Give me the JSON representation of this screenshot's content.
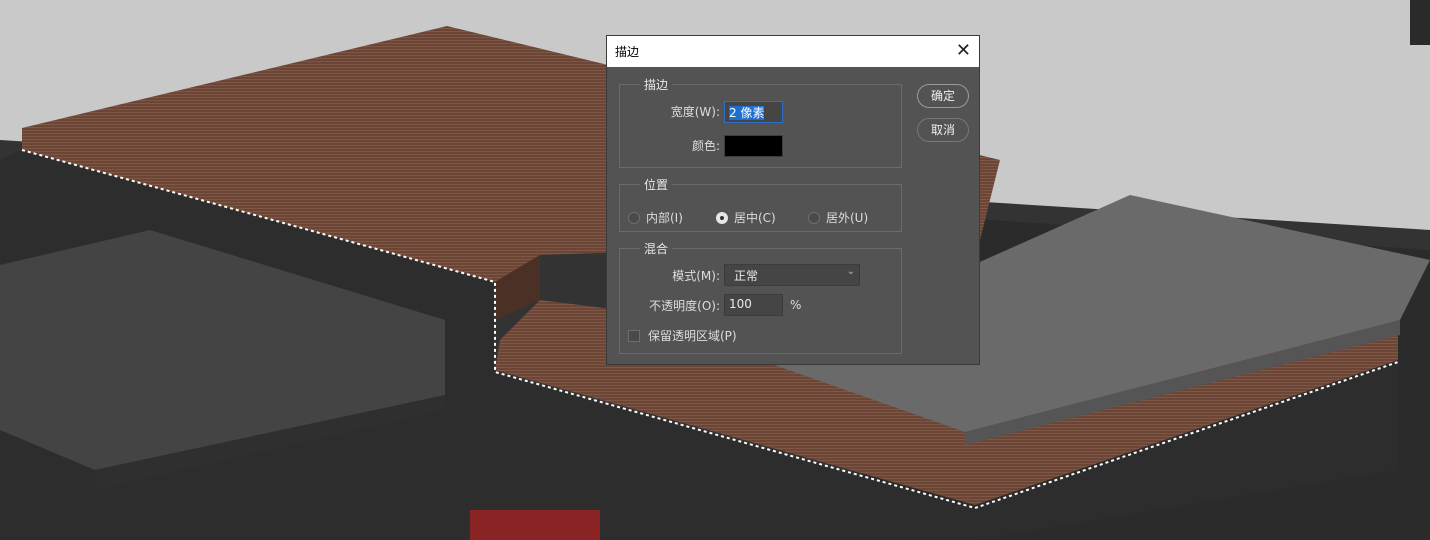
{
  "dialog": {
    "title": "描边",
    "stroke_group": {
      "legend": "描边",
      "width_label": "宽度(W):",
      "width_value": "2 像素",
      "color_label": "颜色:",
      "color_value": "#000000"
    },
    "position_group": {
      "legend": "位置",
      "options": [
        "内部(I)",
        "居中(C)",
        "居外(U)"
      ],
      "selected": "居中(C)"
    },
    "blend_group": {
      "legend": "混合",
      "mode_label": "模式(M):",
      "mode_value": "正常",
      "opacity_label": "不透明度(O):",
      "opacity_value": "100",
      "opacity_unit": "%",
      "preserve_label": "保留透明区域(P)",
      "preserve_checked": false
    },
    "ok_label": "确定",
    "cancel_label": "取消",
    "close_icon": "close-icon"
  }
}
